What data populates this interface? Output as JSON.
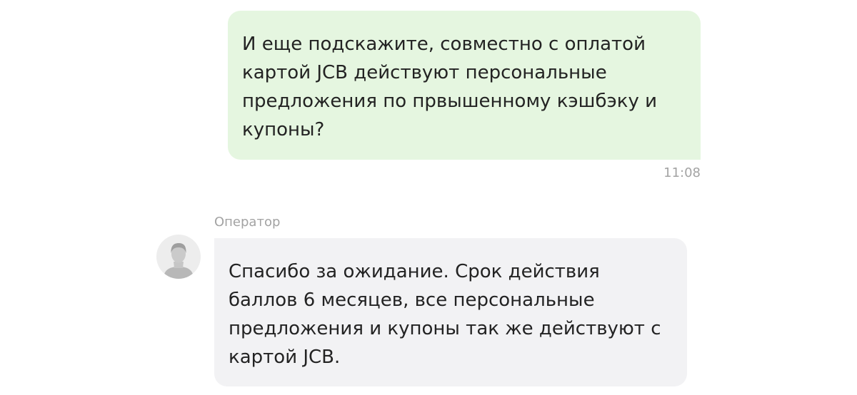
{
  "messages": {
    "outgoing": {
      "lines": [
        "И еще подскажите, совместно с оплатой",
        "картой JCB действуют персональные",
        "предложения по првышенному кэшбэку и",
        "купоны?"
      ],
      "time": "11:08"
    },
    "incoming": {
      "sender": "Оператор",
      "avatar_icon": "user-avatar-icon",
      "lines": [
        "Спасибо за ожидание. Срок действия",
        "баллов 6 месяцев, все персональные",
        "предложения и купоны так же действуют с",
        "картой JCB."
      ]
    }
  },
  "colors": {
    "outgoing_bubble": "#e5f6e0",
    "incoming_bubble": "#f2f2f4",
    "meta_text": "#a3a3a3",
    "message_text": "#232323"
  }
}
